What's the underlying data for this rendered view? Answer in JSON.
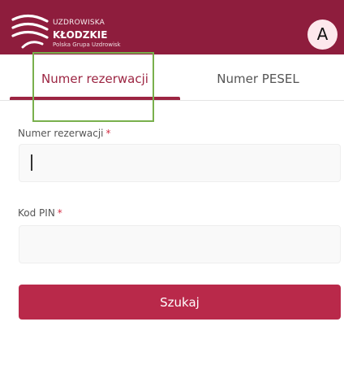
{
  "header": {
    "logo": {
      "line1": "UZDROWISKA",
      "line2": "KŁODZKIE",
      "line3": "Polska Grupa Uzdrowisk"
    },
    "avatar_letter": "A"
  },
  "tabs": [
    {
      "label": "Numer rezerwacji",
      "active": true
    },
    {
      "label": "Numer PESEL",
      "active": false
    }
  ],
  "form": {
    "reservation": {
      "label": "Numer rezerwacji",
      "required_mark": "*",
      "value": ""
    },
    "pin": {
      "label": "Kod PIN",
      "required_mark": "*",
      "value": ""
    },
    "submit_label": "Szukaj"
  },
  "colors": {
    "header_bg": "#8e1d3d",
    "accent": "#9c2542",
    "button_bg": "#b9294a",
    "highlight": "#79b04c",
    "required": "#d42e45"
  }
}
